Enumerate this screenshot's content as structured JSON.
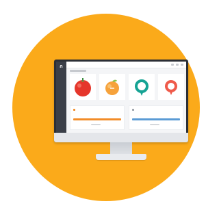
{
  "colors": {
    "background_circle": "#FBAA1A",
    "monitor_bezel": "#2b2f36",
    "sidebar": "#3a3f48",
    "screen_bg": "#f4f5f7",
    "accent_orange": "#F28C28",
    "accent_blue": "#5B9BD5",
    "tomato_red": "#E5362B",
    "leaf_green": "#4CAF50",
    "peach_orange": "#F6A23B",
    "teal": "#16A394",
    "coral": "#EF5A4A"
  },
  "icons": {
    "app_logo": "app-logo-icon",
    "tiles": [
      {
        "name": "tomato-icon"
      },
      {
        "name": "peach-icon"
      },
      {
        "name": "green-location-pin-icon"
      },
      {
        "name": "red-location-pin-icon"
      }
    ]
  },
  "app": {
    "logo_glyph": "∩"
  }
}
